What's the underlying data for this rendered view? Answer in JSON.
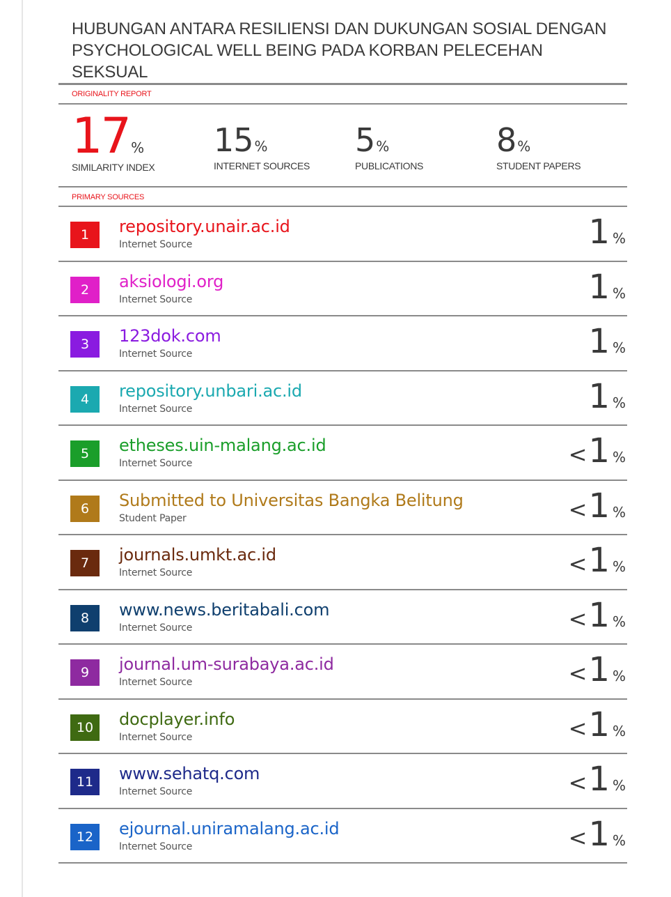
{
  "title": "HUBUNGAN ANTARA RESILIENSI DAN DUKUNGAN SOSIAL DENGAN PSYCHOLOGICAL WELL BEING PADA KORBAN PELECEHAN SEKSUAL",
  "originality_label": "ORIGINALITY REPORT",
  "stats": [
    {
      "value": "17",
      "unit": "%",
      "label": "SIMILARITY INDEX"
    },
    {
      "value": "15",
      "unit": "%",
      "label": "INTERNET SOURCES"
    },
    {
      "value": "5",
      "unit": "%",
      "label": "PUBLICATIONS"
    },
    {
      "value": "8",
      "unit": "%",
      "label": "STUDENT PAPERS"
    }
  ],
  "primary_label": "PRIMARY SOURCES",
  "sources": [
    {
      "rank": "1",
      "name": "repository.unair.ac.id",
      "type": "Internet Source",
      "prefix": "",
      "pct": "1",
      "unit": "%",
      "color": "#e8141b"
    },
    {
      "rank": "2",
      "name": "aksiologi.org",
      "type": "Internet Source",
      "prefix": "",
      "pct": "1",
      "unit": "%",
      "color": "#e020c8"
    },
    {
      "rank": "3",
      "name": "123dok.com",
      "type": "Internet Source",
      "prefix": "",
      "pct": "1",
      "unit": "%",
      "color": "#8a1be0"
    },
    {
      "rank": "4",
      "name": "repository.unbari.ac.id",
      "type": "Internet Source",
      "prefix": "",
      "pct": "1",
      "unit": "%",
      "color": "#1ba9b0"
    },
    {
      "rank": "5",
      "name": "etheses.uin-malang.ac.id",
      "type": "Internet Source",
      "prefix": "<",
      "pct": "1",
      "unit": "%",
      "color": "#1a9e2a"
    },
    {
      "rank": "6",
      "name": "Submitted to Universitas Bangka Belitung",
      "type": "Student Paper",
      "prefix": "<",
      "pct": "1",
      "unit": "%",
      "color": "#b07a1a"
    },
    {
      "rank": "7",
      "name": "journals.umkt.ac.id",
      "type": "Internet Source",
      "prefix": "<",
      "pct": "1",
      "unit": "%",
      "color": "#6a2a0e"
    },
    {
      "rank": "8",
      "name": "www.news.beritabali.com",
      "type": "Internet Source",
      "prefix": "<",
      "pct": "1",
      "unit": "%",
      "color": "#0f3f6e"
    },
    {
      "rank": "9",
      "name": "journal.um-surabaya.ac.id",
      "type": "Internet Source",
      "prefix": "<",
      "pct": "1",
      "unit": "%",
      "color": "#8e2aa0"
    },
    {
      "rank": "10",
      "name": "docplayer.info",
      "type": "Internet Source",
      "prefix": "<",
      "pct": "1",
      "unit": "%",
      "color": "#3f6a12"
    },
    {
      "rank": "11",
      "name": "www.sehatq.com",
      "type": "Internet Source",
      "prefix": "<",
      "pct": "1",
      "unit": "%",
      "color": "#1e2a8a"
    },
    {
      "rank": "12",
      "name": "ejournal.uniramalang.ac.id",
      "type": "Internet Source",
      "prefix": "<",
      "pct": "1",
      "unit": "%",
      "color": "#1a64c8"
    }
  ]
}
